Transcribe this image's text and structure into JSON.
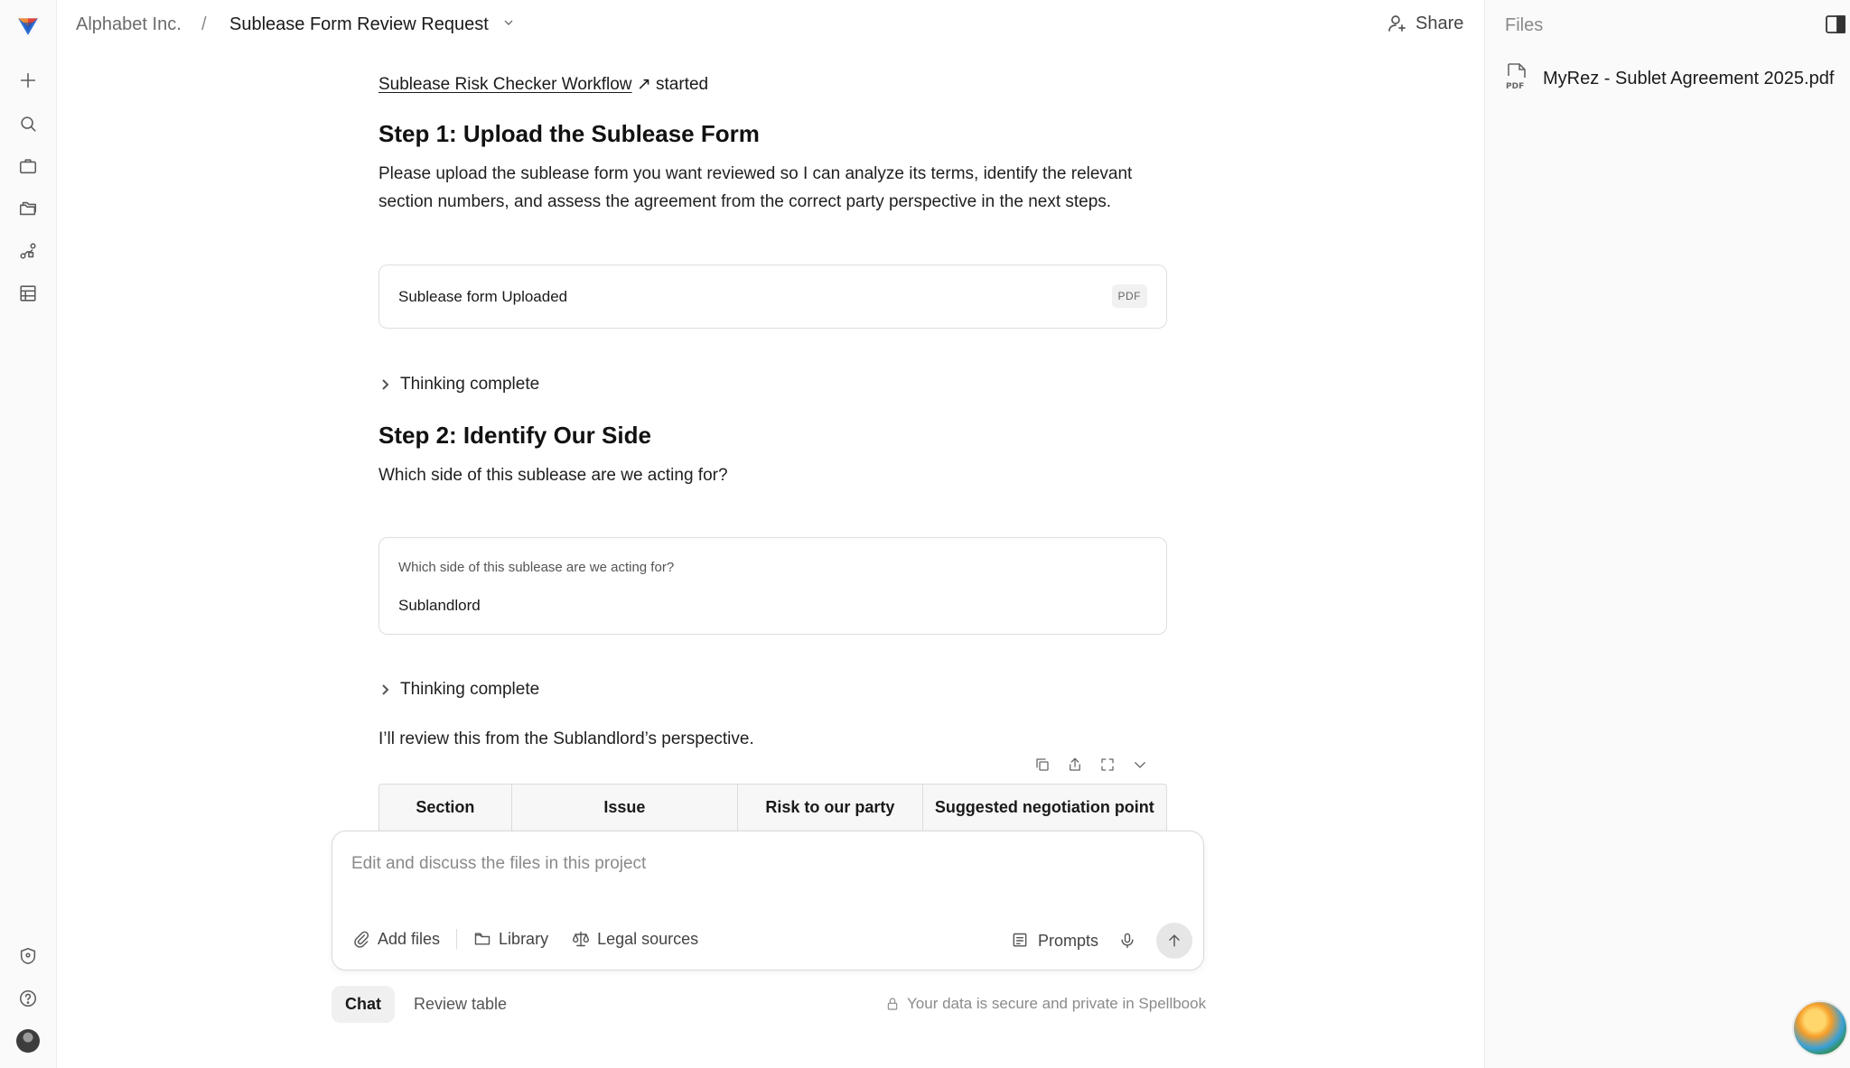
{
  "header": {
    "org": "Alphabet Inc.",
    "separator": "/",
    "title": "Sublease Form Review Request",
    "share_label": "Share"
  },
  "files_panel": {
    "title": "Files",
    "files": [
      {
        "name": "MyRez - Sublet Agreement 2025.pdf",
        "type": "PDF"
      }
    ]
  },
  "conversation": {
    "workflow_link": "Sublease Risk Checker Workflow",
    "workflow_arrow": "↗",
    "workflow_status": "started",
    "step1": {
      "heading": "Step 1: Upload the Sublease Form",
      "body": "Please upload the sublease form you want reviewed so I can analyze its terms, identify the relevant section numbers, and assess the agreement from the correct party perspective in the next steps.",
      "upload_label": "Sublease form Uploaded",
      "badge": "PDF"
    },
    "thinking_1": "Thinking complete",
    "step2": {
      "heading": "Step 2: Identify Our Side",
      "body": "Which side of this sublease are we acting for?",
      "question": "Which side of this sublease are we acting for?",
      "answer": "Sublandlord"
    },
    "thinking_2": "Thinking complete",
    "review_note": "I’ll review this from the Sublandlord’s perspective.",
    "table": {
      "headers": [
        "Section",
        "Issue",
        "Risk to our party",
        "Suggested negotiation point"
      ]
    }
  },
  "composer": {
    "placeholder": "Edit and discuss the files in this project",
    "add_files": "Add files",
    "library": "Library",
    "legal_sources": "Legal sources",
    "prompts": "Prompts"
  },
  "tabs": {
    "chat": "Chat",
    "review_table": "Review table"
  },
  "privacy_note": "Your data is secure and private in Spellbook",
  "colors": {
    "logo_orange": "#f28b30",
    "logo_red": "#e2423a",
    "logo_blue": "#2a6fd6",
    "text": "#1a1a1a",
    "muted": "#8a8a8a"
  }
}
